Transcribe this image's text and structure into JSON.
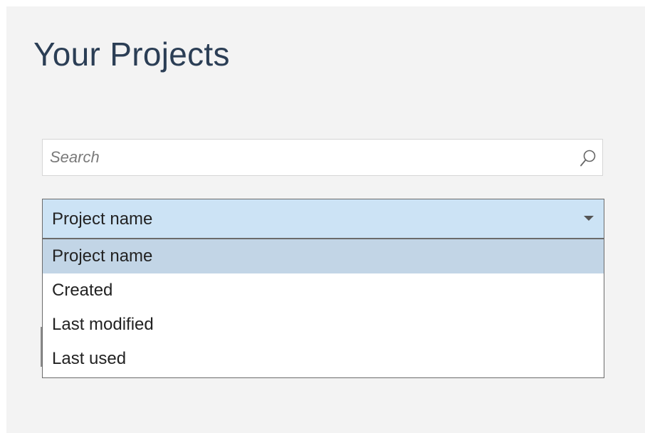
{
  "header": {
    "title": "Your Projects"
  },
  "search": {
    "placeholder": "Search",
    "value": "",
    "icon": "search-icon"
  },
  "sort": {
    "selected_label": "Project name",
    "icon": "chevron-down-icon",
    "options": [
      {
        "label": "Project name",
        "selected": true
      },
      {
        "label": "Created",
        "selected": false
      },
      {
        "label": "Last modified",
        "selected": false
      },
      {
        "label": "Last used",
        "selected": false
      }
    ]
  },
  "colors": {
    "title": "#2b3e55",
    "panel_background": "#f3f3f3",
    "select_background": "#cce3f5",
    "selected_option_background": "#c2d5e6"
  }
}
